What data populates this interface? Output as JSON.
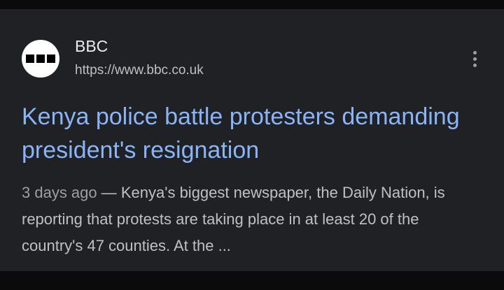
{
  "source": {
    "name": "BBC",
    "url": "https://www.bbc.co.uk",
    "logo_letters": [
      "B",
      "B",
      "C"
    ],
    "logo_icon": "bbc-logo-icon",
    "more_icon": "more-vert-icon"
  },
  "result": {
    "headline": "Kenya police battle protesters demanding president's resignation",
    "date": "3 days ago",
    "separator": " — ",
    "snippet": "Kenya's biggest newspaper, the Daily Nation, is reporting that protests are taking place in at least 20 of the country's 47 counties. At the ..."
  },
  "colors": {
    "background": "#202124",
    "link": "#8ab4f8",
    "text": "#bdc1c6",
    "title": "#e8eaed"
  }
}
